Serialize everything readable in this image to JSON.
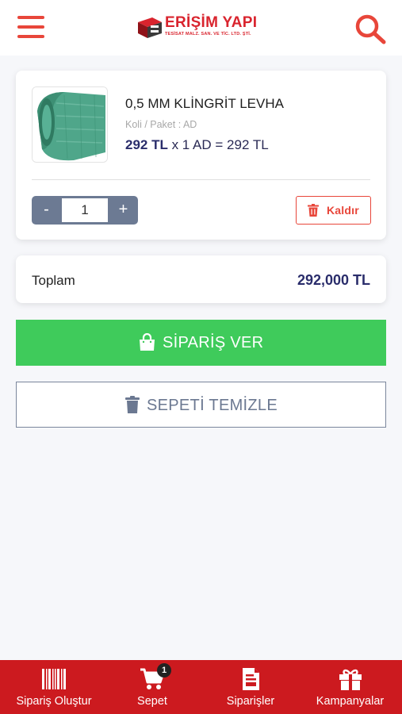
{
  "header": {
    "logo_title": "ERİŞİM YAPI",
    "logo_subtitle": "TESİSAT MALZ. SAN. VE TİC. LTD. ŞTİ.",
    "menu_icon": "hamburger-menu-icon",
    "search_icon": "search-icon"
  },
  "cart_item": {
    "name": "0,5 MM KLİNGRİT LEVHA",
    "package": "Koli / Paket : AD",
    "unit_price": "292 TL",
    "price_formula": " x 1 AD = 292 TL",
    "quantity": "1",
    "minus_label": "-",
    "plus_label": "+",
    "remove_label": "Kaldır"
  },
  "summary": {
    "total_label": "Toplam",
    "total_value": "292,000 TL"
  },
  "actions": {
    "order_label": "SİPARİŞ VER",
    "clear_label": "SEPETİ TEMİZLE"
  },
  "bottom_nav": {
    "items": [
      {
        "label": "Sipariş Oluştur",
        "icon": "barcode-icon"
      },
      {
        "label": "Sepet",
        "icon": "cart-icon",
        "badge": "1"
      },
      {
        "label": "Siparişler",
        "icon": "orders-document-icon"
      },
      {
        "label": "Kampanyalar",
        "icon": "gift-icon"
      }
    ]
  },
  "colors": {
    "accent_red": "#e8463a",
    "nav_red": "#cc1a1f",
    "order_green": "#3fcb5b",
    "price_navy": "#2a2d6b",
    "stepper_gray": "#6c7a93"
  }
}
